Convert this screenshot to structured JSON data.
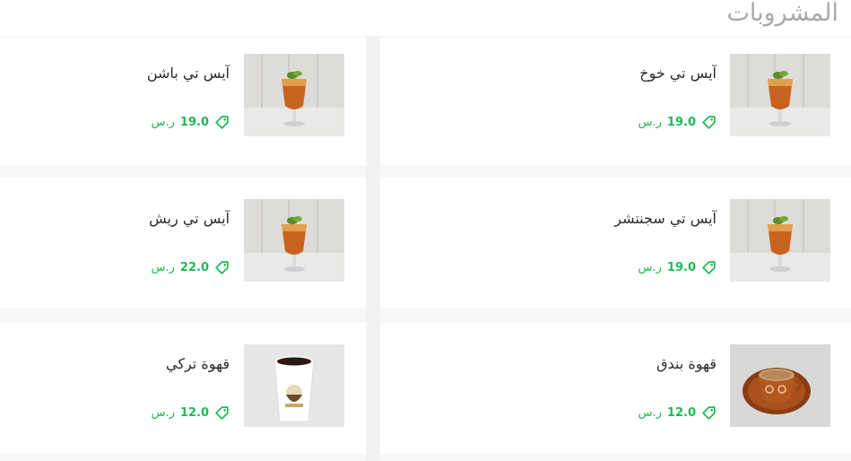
{
  "section": {
    "title": "المشروبات"
  },
  "colors": {
    "accent": "#1db954",
    "title": "#a9a9a9"
  },
  "items": [
    {
      "name": "آيس تي خوخ",
      "price": "19.0",
      "currency": "ر.س",
      "image": "iced-tea-glass"
    },
    {
      "name": "آيس تي باشن",
      "price": "19.0",
      "currency": "ر.س",
      "image": "iced-tea-glass"
    },
    {
      "name": "آيس تي سجنتشر",
      "price": "19.0",
      "currency": "ر.س",
      "image": "iced-tea-glass"
    },
    {
      "name": "آيس تي ريش",
      "price": "22.0",
      "currency": "ر.س",
      "image": "iced-tea-glass"
    },
    {
      "name": "قهوة بندق",
      "price": "12.0",
      "currency": "ر.س",
      "image": "coffee-cup-saucer"
    },
    {
      "name": "قهوة تركي",
      "price": "12.0",
      "currency": "ر.س",
      "image": "paper-coffee-cup"
    }
  ]
}
